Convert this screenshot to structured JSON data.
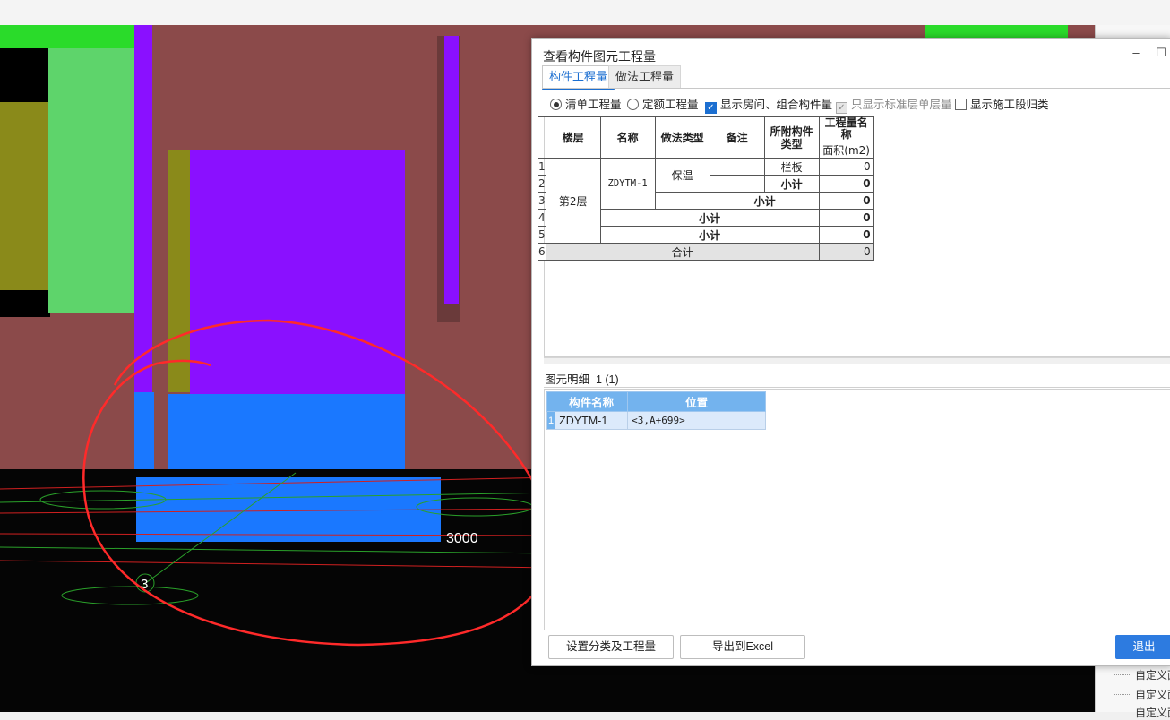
{
  "dialog": {
    "title": "查看构件图元工程量",
    "minimize": "–",
    "maximize": "☐",
    "tabs": [
      {
        "label": "构件工程量",
        "active": true
      },
      {
        "label": "做法工程量",
        "active": false
      }
    ],
    "options": {
      "qd_label": "清单工程量",
      "de_label": "定额工程量",
      "show_room_label": "显示房间、组合构件量",
      "std_floor_label": "只显示标准层单层量",
      "construction_label": "显示施工段归类"
    },
    "table": {
      "headers": {
        "floor": "楼层",
        "name": "名称",
        "method_type": "做法类型",
        "remark": "备注",
        "attached_type": "所附构件类型",
        "qty_name": "工程量名称",
        "qty_sub": "面积(m2)"
      },
      "row_numbers": [
        "1",
        "2",
        "3",
        "4",
        "5",
        "6"
      ],
      "floor": "第2层",
      "name": "ZDYTM-1",
      "method": "保温",
      "remark": "–",
      "attached": "栏板",
      "subtotal": "小计",
      "total": "合计",
      "values": [
        "0",
        "0",
        "0",
        "0",
        "0",
        "0"
      ]
    },
    "detail": {
      "label": "图元明细",
      "count": "1 (1)",
      "headers": {
        "name": "构件名称",
        "position": "位置"
      },
      "row_number": "1",
      "row": {
        "name": "ZDYTM-1",
        "position": "<3,A+699>"
      }
    },
    "buttons": {
      "settings": "设置分类及工程量",
      "export": "导出到Excel",
      "exit": "退出"
    }
  },
  "right_panel": {
    "items": [
      "自定义面",
      "自定义面",
      "自定义面"
    ]
  },
  "viewport": {
    "dimension_label": "3000",
    "axis_label": "3"
  }
}
